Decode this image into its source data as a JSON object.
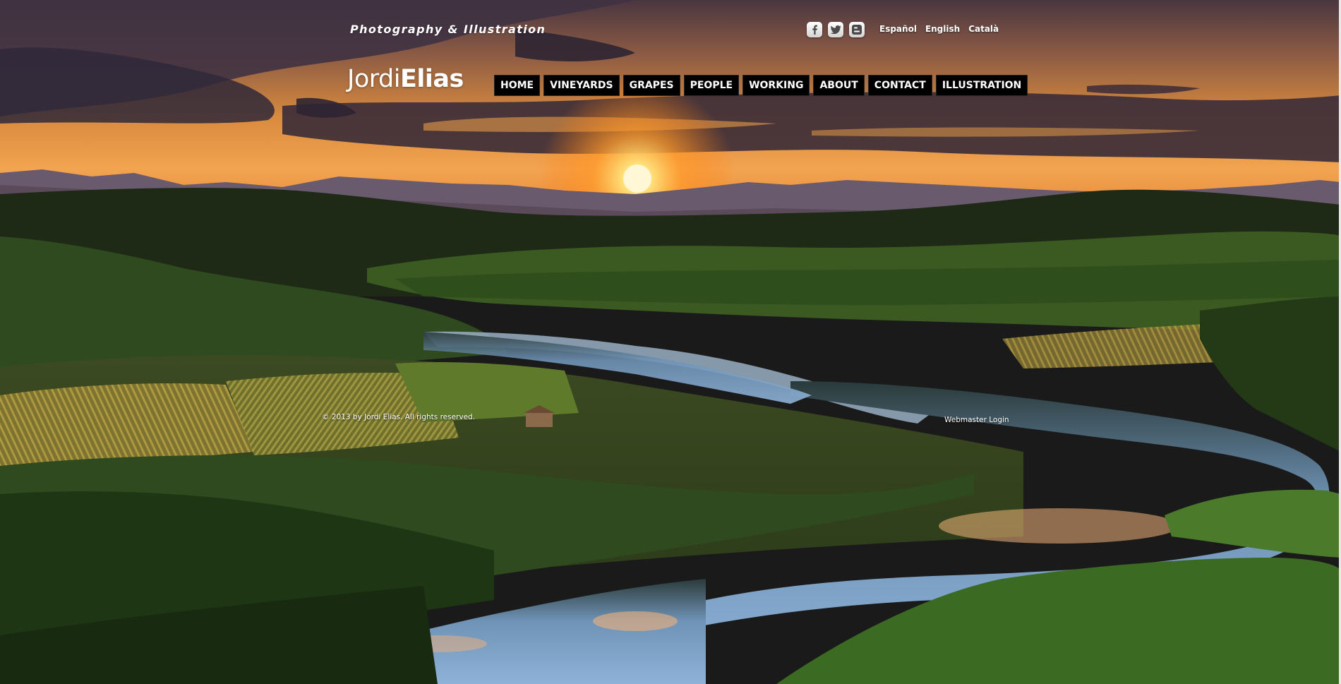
{
  "header": {
    "tagline": "Photography & Illustration",
    "logo_first": "Jordi",
    "logo_last": "Elias"
  },
  "social": {
    "items": [
      {
        "icon": "facebook-icon"
      },
      {
        "icon": "twitter-icon"
      },
      {
        "icon": "blogger-icon"
      }
    ]
  },
  "languages": [
    "Español",
    "English",
    "Català"
  ],
  "nav": {
    "items": [
      "HOME",
      "VINEYARDS",
      "GRAPES",
      "PEOPLE",
      "WORKING",
      "ABOUT",
      "CONTACT",
      "ILLUSTRATION"
    ]
  },
  "footer": {
    "copyright": "© 2013 by Jordi Elias. All rights reserved.",
    "login": "Webmaster Login"
  },
  "colors": {
    "nav_background": "#000000",
    "nav_text": "#ffffff",
    "sky_glow": "#f39a2c",
    "water": "#7ea7cf"
  }
}
